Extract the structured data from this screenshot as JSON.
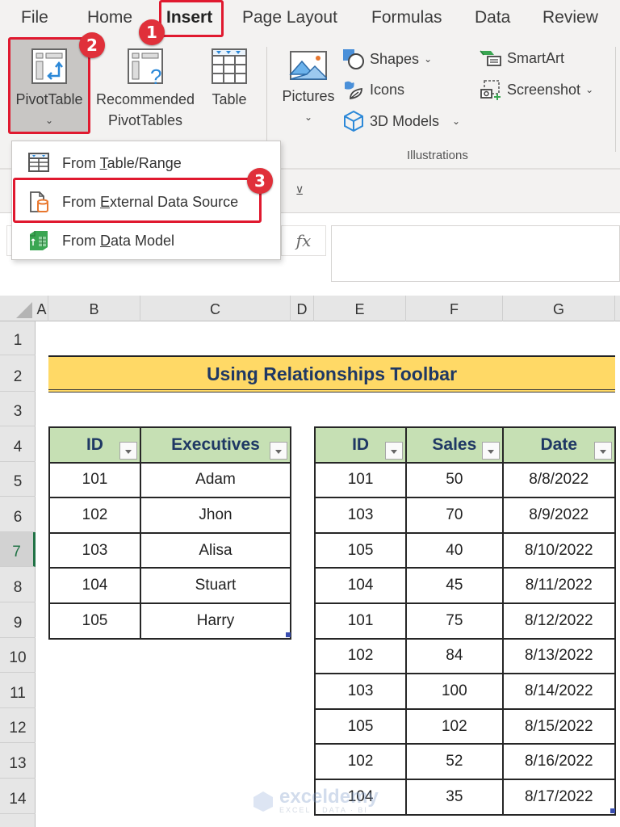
{
  "ribbon": {
    "tabs": [
      {
        "label": "File",
        "active": false
      },
      {
        "label": "Home",
        "active": false
      },
      {
        "label": "Insert",
        "active": true
      },
      {
        "label": "Page Layout",
        "active": false
      },
      {
        "label": "Formulas",
        "active": false
      },
      {
        "label": "Data",
        "active": false
      },
      {
        "label": "Review",
        "active": false
      }
    ],
    "tables_group": {
      "pivot_table": "PivotTable",
      "recommended_line1": "Recommended",
      "recommended_line2": "PivotTables",
      "table": "Table"
    },
    "illustrations_group": {
      "pictures": "Pictures",
      "shapes": "Shapes",
      "icons": "Icons",
      "models_3d": "3D Models",
      "smartart": "SmartArt",
      "screenshot": "Screenshot",
      "group_label": "Illustrations"
    }
  },
  "pivot_dropdown": {
    "items": [
      {
        "pre": "From ",
        "accel": "T",
        "post": "able/Range",
        "icon": "table-range-icon"
      },
      {
        "pre": "From ",
        "accel": "E",
        "post": "xternal Data Source",
        "icon": "external-data-icon"
      },
      {
        "pre": "From ",
        "accel": "D",
        "post": "ata Model",
        "icon": "data-model-icon"
      }
    ]
  },
  "annotations": {
    "step1": "1",
    "step2": "2",
    "step3": "3",
    "highlight_color": "#e0192f"
  },
  "formula_bar": {
    "fx_label": "fx",
    "value": ""
  },
  "grid": {
    "columns": [
      "A",
      "B",
      "C",
      "D",
      "E",
      "F",
      "G"
    ],
    "rows": [
      "1",
      "2",
      "3",
      "4",
      "5",
      "6",
      "7",
      "8",
      "9",
      "10",
      "11",
      "12",
      "13",
      "14"
    ],
    "selected_row": "7"
  },
  "sheet": {
    "title": "Using Relationships Toolbar",
    "title_bg": "#ffd966",
    "header_bg": "#c6e0b4",
    "executives_table": {
      "headers": [
        "ID",
        "Executives"
      ],
      "rows": [
        [
          "101",
          "Adam"
        ],
        [
          "102",
          "Jhon"
        ],
        [
          "103",
          "Alisa"
        ],
        [
          "104",
          "Stuart"
        ],
        [
          "105",
          "Harry"
        ]
      ]
    },
    "sales_table": {
      "headers": [
        "ID",
        "Sales",
        "Date"
      ],
      "rows": [
        [
          "101",
          "50",
          "8/8/2022"
        ],
        [
          "103",
          "70",
          "8/9/2022"
        ],
        [
          "105",
          "40",
          "8/10/2022"
        ],
        [
          "104",
          "45",
          "8/11/2022"
        ],
        [
          "101",
          "75",
          "8/12/2022"
        ],
        [
          "102",
          "84",
          "8/13/2022"
        ],
        [
          "103",
          "100",
          "8/14/2022"
        ],
        [
          "105",
          "102",
          "8/15/2022"
        ],
        [
          "102",
          "52",
          "8/16/2022"
        ],
        [
          "104",
          "35",
          "8/17/2022"
        ]
      ]
    }
  },
  "watermark": {
    "brand": "exceldemy",
    "tagline": "EXCEL · DATA · BI"
  }
}
